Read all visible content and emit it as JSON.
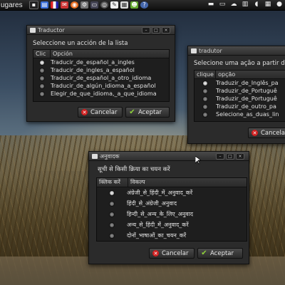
{
  "panel": {
    "menu_label": "ugares"
  },
  "window_es": {
    "title": "Traductor",
    "prompt": "Seleccione un acción de la lista",
    "columns": [
      "Clic",
      "Opción"
    ],
    "rows": [
      "Traducir_de_español_a_ingles",
      "Traducir_de_ingles_a_español",
      "Traducir_de_español_a_otro_idioma",
      "Traducir_de_algún_idioma_a_español",
      "Elegir_de_que_idioma,_a_que_idioma"
    ],
    "cancel_label": "Cancelar",
    "ok_label": "Aceptar"
  },
  "window_pt": {
    "title": "tradutor",
    "prompt": "Selecione uma ação a partir da",
    "columns": [
      "clique",
      "opção"
    ],
    "rows": [
      "Traduzir_de_Inglês_pa",
      "Traduzir_de_Portuguê",
      "Traduzir_de_Portuguê",
      "Traduzir_de_outro_pa",
      "Selecione_as_duas_lin"
    ],
    "cancel_label": "Cancela"
  },
  "window_hi": {
    "title": "अनुवादक",
    "prompt": "सूची से किसी क्रिया का चयन करें",
    "columns": [
      "क्लिक करें",
      "विकल्प"
    ],
    "rows": [
      "अंग्रेजी_से_हिंदी_में_अनुवाद_करें",
      "हिंदी_से_अंग्रेजी_अनुवाद",
      "हिन्दी_से_अन्य_के_लिए_अनुवाद",
      "अन्य_से_हिंदी_में_अनुवाद_करें",
      "दोनों_भाषाओं_का_चयन_करें"
    ],
    "cancel_label": "Cancelar",
    "ok_label": "Aceptar"
  }
}
